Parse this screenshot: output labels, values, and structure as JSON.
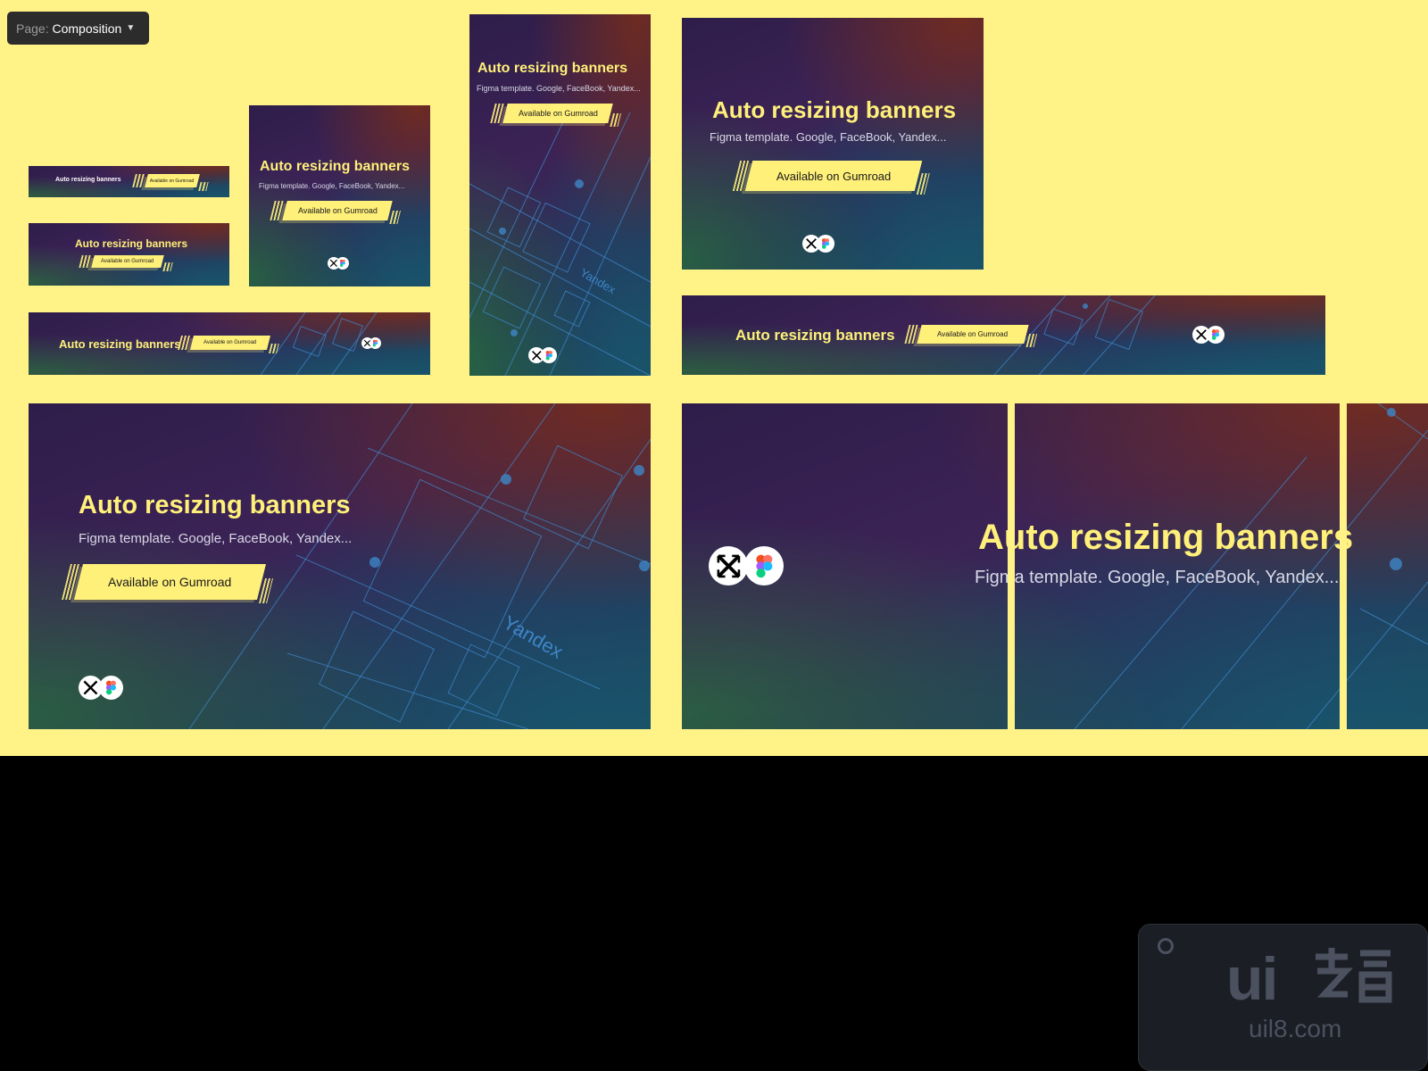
{
  "page_selector": {
    "label": "Page:",
    "value": "Composition"
  },
  "banner": {
    "title": "Auto resizing banners",
    "subtitle": "Figma template. Google, FaceBook, Yandex...",
    "cta": "Available on Gumroad",
    "wire_label": "Yandex"
  },
  "icons": [
    "resize-arrows-icon",
    "figma-icon"
  ],
  "colors": {
    "canvas": "#FFF388",
    "accent": "#FFF07A",
    "frame": "#2c2c2c",
    "wire": "#3d86c6"
  },
  "watermark": {
    "logo": "ui",
    "url": "uil8.com"
  }
}
